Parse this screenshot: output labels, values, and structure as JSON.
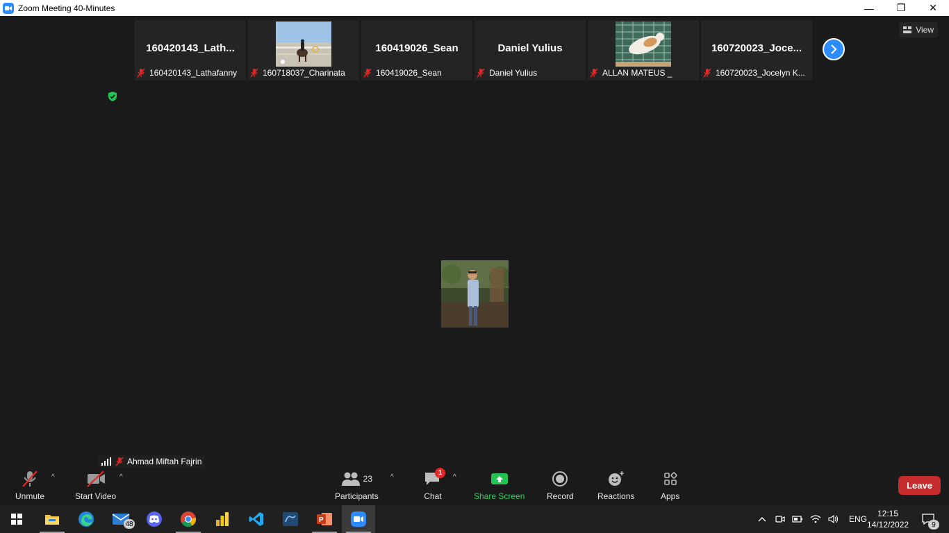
{
  "window": {
    "title": "Zoom Meeting 40-Minutes",
    "minimize": "—",
    "restore": "❐",
    "close": "✕"
  },
  "view_button": {
    "label": "View"
  },
  "participants_strip": [
    {
      "big_name": "160420143_Lath...",
      "label": "160420143_Lathafanny",
      "has_photo": false
    },
    {
      "big_name": "",
      "label": "160718037_Charinata",
      "has_photo": true
    },
    {
      "big_name": "160419026_Sean",
      "label": "160419026_Sean",
      "has_photo": false
    },
    {
      "big_name": "Daniel Yulius",
      "label": "Daniel Yulius",
      "has_photo": false
    },
    {
      "big_name": "",
      "label": "ALLAN MATEUS _",
      "has_photo": true
    },
    {
      "big_name": "160720023_Joce...",
      "label": "160720023_Jocelyn K...",
      "has_photo": false
    }
  ],
  "self_view": {
    "name": "Ahmad Miftah Fajrin"
  },
  "toolbar": {
    "unmute": "Unmute",
    "start_video": "Start Video",
    "participants": "Participants",
    "participants_count": "23",
    "chat": "Chat",
    "chat_badge": "1",
    "share_screen": "Share Screen",
    "record": "Record",
    "reactions": "Reactions",
    "apps": "Apps",
    "leave": "Leave",
    "caret": "^"
  },
  "taskbar": {
    "mail_badge": "48",
    "language": "ENG",
    "time": "12:15",
    "date": "14/12/2022",
    "notifications_badge": "9"
  },
  "colors": {
    "zoom_blue": "#2d8cff",
    "leave_red": "#c72c2c",
    "share_green": "#2fd15e",
    "muted_red": "#e02828"
  }
}
